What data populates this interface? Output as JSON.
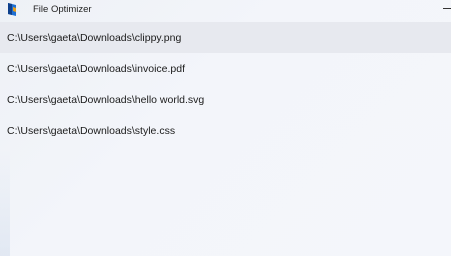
{
  "window": {
    "title": "File Optimizer"
  },
  "files": [
    {
      "path": "C:\\Users\\gaeta\\Downloads\\clippy.png",
      "selected": true
    },
    {
      "path": "C:\\Users\\gaeta\\Downloads\\invoice.pdf",
      "selected": false
    },
    {
      "path": "C:\\Users\\gaeta\\Downloads\\hello world.svg",
      "selected": false
    },
    {
      "path": "C:\\Users\\gaeta\\Downloads\\style.css",
      "selected": false
    }
  ],
  "colors": {
    "selected_row": "#e7e9ef",
    "background": "#f3f5fa",
    "text": "#1b1b1b"
  }
}
